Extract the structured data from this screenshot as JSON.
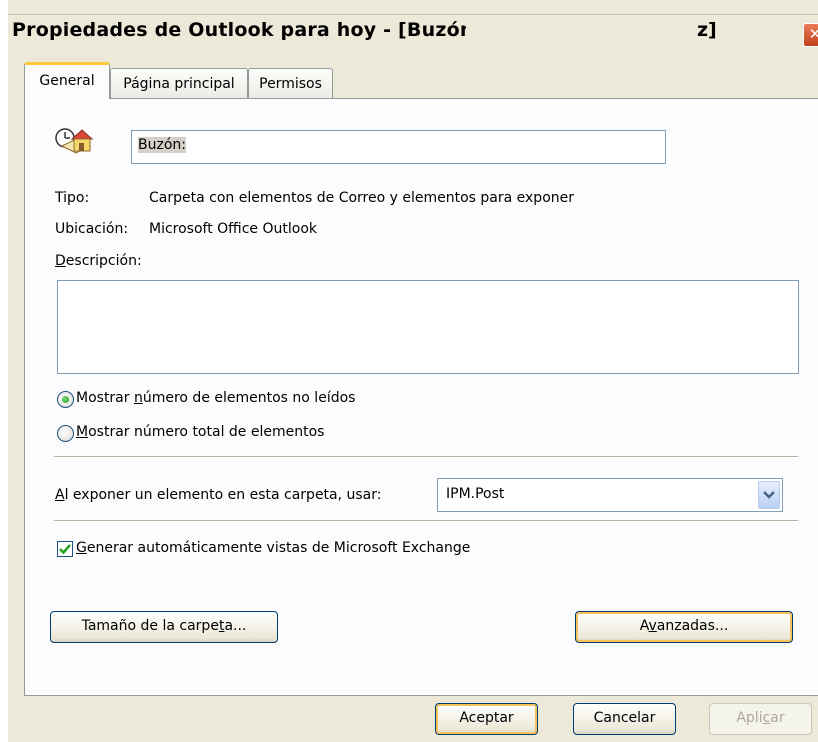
{
  "window": {
    "title_prefix": "Propiedades de Outlook para hoy - [Buzón:",
    "title_suffix": "z]",
    "close_glyph": "✕"
  },
  "tabs": [
    {
      "label": "General",
      "active": true
    },
    {
      "label": "Página principal",
      "active": false
    },
    {
      "label": "Permisos",
      "active": false
    }
  ],
  "general": {
    "icon": "outlook-today-home-icon",
    "name_value": "Buzón:",
    "tipo_label": "Tipo:",
    "tipo_value": "Carpeta con elementos de Correo y elementos para exponer",
    "ubicacion_label": "Ubicación:",
    "ubicacion_value": "Microsoft Office Outlook",
    "descripcion_label_pre": "",
    "descripcion_label_mnemonic": "D",
    "descripcion_label_post": "escripción:",
    "descripcion_value": "",
    "radio_unread_pre": "Mostrar ",
    "radio_unread_mnemonic": "n",
    "radio_unread_post": "úmero de elementos no leídos",
    "radio_unread_checked": true,
    "radio_total_pre": "",
    "radio_total_mnemonic": "M",
    "radio_total_post": "ostrar número total de elementos",
    "radio_total_checked": false,
    "post_label_pre": "",
    "post_label_mnemonic": "A",
    "post_label_post": "l exponer un elemento en esta carpeta, usar:",
    "post_select_value": "IPM.Post",
    "exchange_views_pre": "",
    "exchange_views_mnemonic": "G",
    "exchange_views_post": "enerar automáticamente vistas de Microsoft Exchange",
    "exchange_views_checked": true,
    "folder_size_pre": "Tamaño de la carpe",
    "folder_size_mnemonic": "t",
    "folder_size_post": "a...",
    "advanced_pre": "A",
    "advanced_mnemonic": "v",
    "advanced_post": "anzadas..."
  },
  "footer": {
    "ok_label": "Aceptar",
    "cancel_label": "Cancelar",
    "apply_pre": "Apli",
    "apply_mnemonic": "c",
    "apply_post": "ar",
    "apply_enabled": false
  },
  "colors": {
    "dialog_bg": "#ece9d8",
    "tab_active_accent": "#ffc83c",
    "button_border": "#003c74",
    "checkmark": "#21a121"
  }
}
